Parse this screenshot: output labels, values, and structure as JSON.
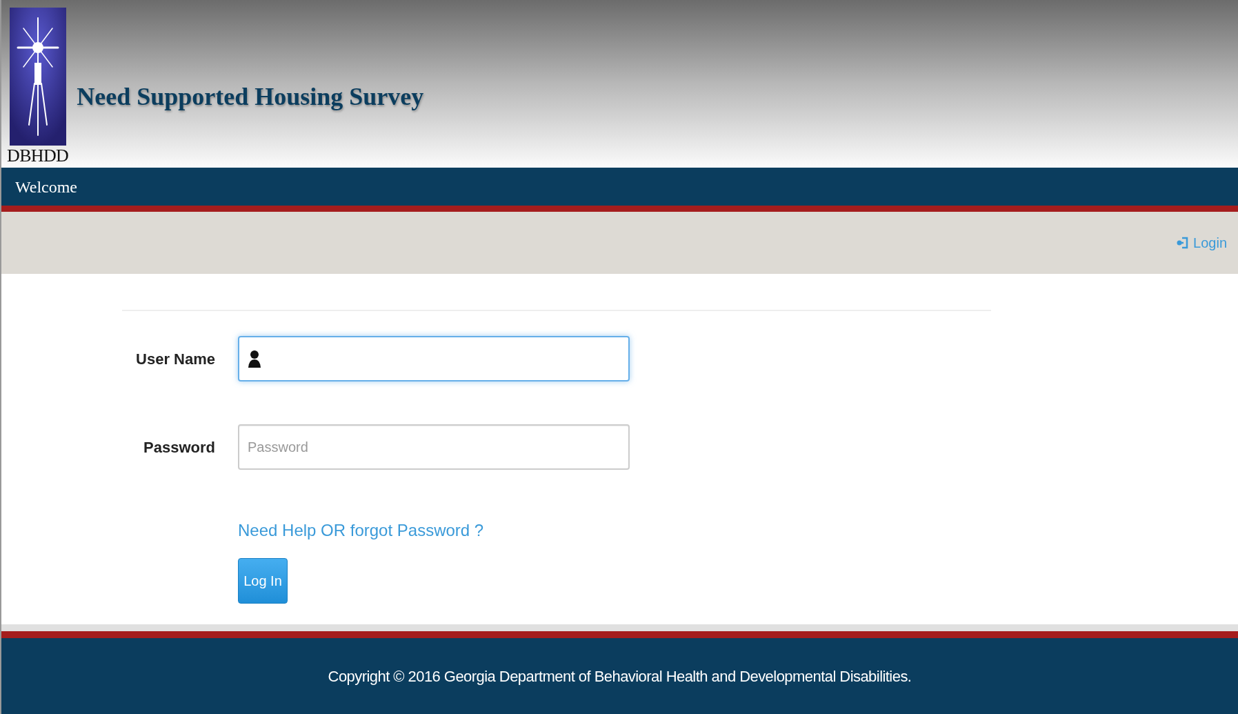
{
  "header": {
    "logo_text": "DBHDD",
    "title": "Need Supported Housing Survey"
  },
  "nav": {
    "items": [
      {
        "label": "Welcome",
        "selected": true
      }
    ]
  },
  "toolbar": {
    "login_link": "Login"
  },
  "form": {
    "username": {
      "label": "User Name",
      "focused": true
    },
    "password": {
      "label": "Password",
      "placeholder": "Password",
      "focused": false
    },
    "help_link": "Need Help OR forgot Password ?",
    "submit": "Log In"
  },
  "footer": {
    "copyright": "Copyright © 2016 Georgia Department of Behavioral Health and Developmental Disabilities."
  }
}
